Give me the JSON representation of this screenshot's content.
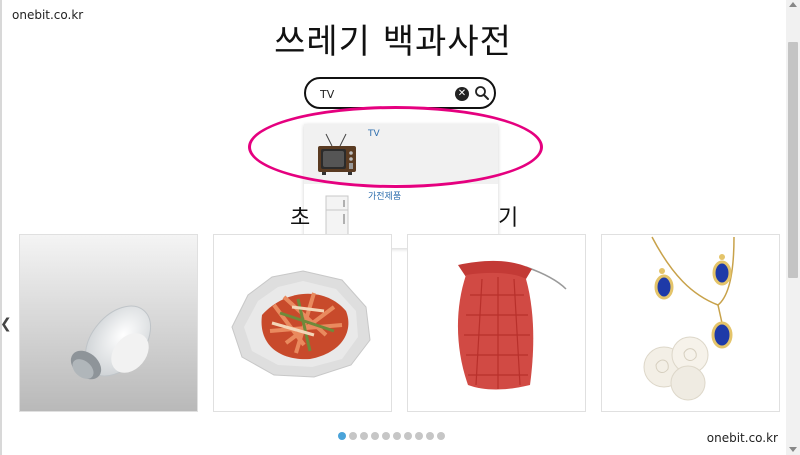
{
  "watermark_top": "onebit.co.kr",
  "watermark_bottom": "onebit.co.kr",
  "title": "쓰레기 백과사전",
  "search": {
    "value": "TV",
    "clear_icon": "clear-icon",
    "search_icon": "search-icon"
  },
  "suggestions": [
    {
      "label": "TV",
      "icon": "tv-icon",
      "active": true
    },
    {
      "label": "가전제품",
      "icon": "refrigerator-icon",
      "active": false
    }
  ],
  "section": {
    "left_text": "초",
    "right_text": "기"
  },
  "cards": [
    {
      "name": "salt-shaker"
    },
    {
      "name": "kimchi"
    },
    {
      "name": "red-mesh-bag"
    },
    {
      "name": "jewelry"
    }
  ],
  "carousel": {
    "dot_count": 10,
    "active_index": 0
  },
  "colors": {
    "highlight": "#e5007f",
    "link": "#2f6fae",
    "active_dot": "#4aa3d9"
  }
}
